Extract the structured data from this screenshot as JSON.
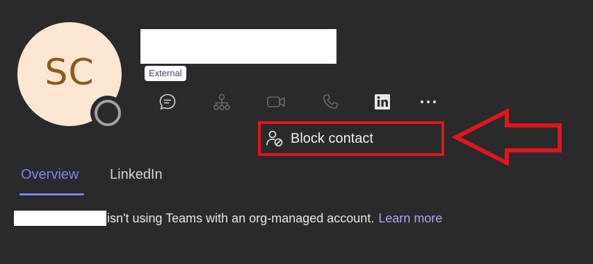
{
  "profile": {
    "initials": "SC",
    "badge": "External",
    "presence": "offline"
  },
  "actions": [
    {
      "name": "chat-icon",
      "enabled": true
    },
    {
      "name": "org-chart-icon",
      "enabled": false
    },
    {
      "name": "video-call-icon",
      "enabled": false
    },
    {
      "name": "phone-call-icon",
      "enabled": false
    },
    {
      "name": "linkedin-icon",
      "enabled": true
    },
    {
      "name": "more-options-icon",
      "enabled": true
    }
  ],
  "menu": {
    "block_contact_label": "Block contact"
  },
  "tabs": [
    {
      "label": "Overview",
      "active": true
    },
    {
      "label": "LinkedIn",
      "active": false
    }
  ],
  "notice": {
    "text": "isn't using Teams with an org-managed account.",
    "link": "Learn more"
  },
  "colors": {
    "background": "#2a292b",
    "accent": "#7f85f5",
    "annotation": "#e0161e",
    "avatar_bg": "#fde7d2",
    "avatar_text": "#8a5a20"
  }
}
